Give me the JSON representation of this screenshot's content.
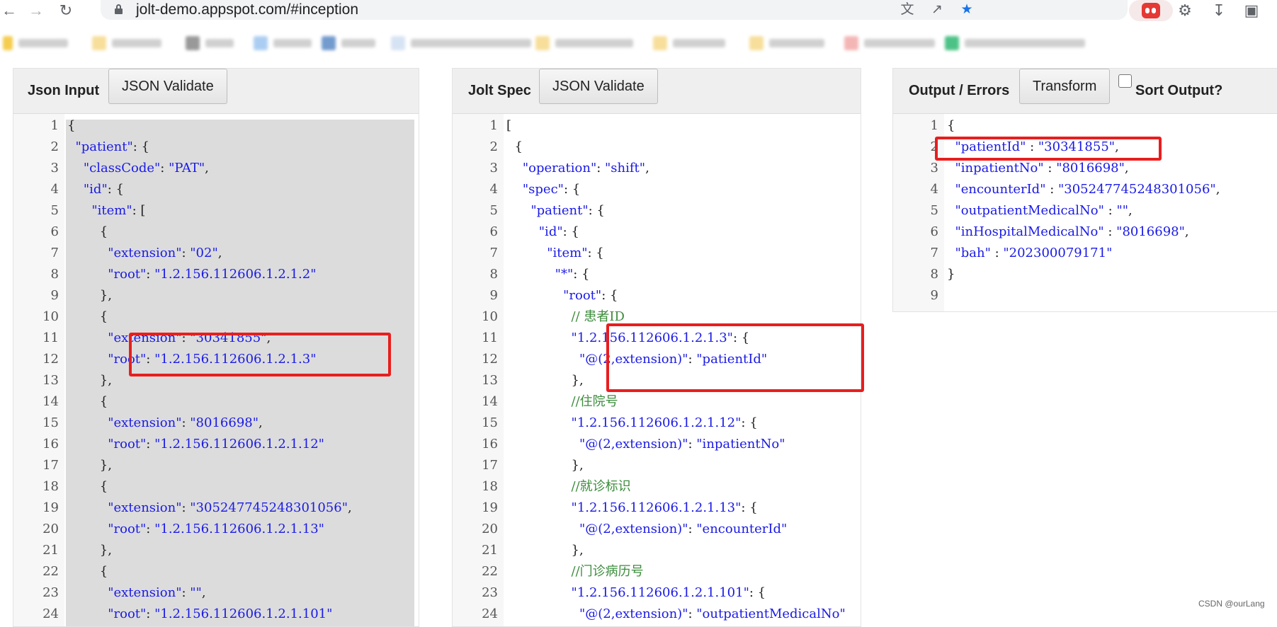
{
  "browser": {
    "url": "jolt-demo.appspot.com/#inception",
    "back_icon": "arrow-left-icon",
    "forward_icon": "arrow-right-icon",
    "reload_icon": "reload-icon",
    "bookmarks_blurred": true
  },
  "panels": {
    "input": {
      "title": "Json Input",
      "button": "JSON Validate",
      "lines": [
        "{",
        "  \"patient\": {",
        "    \"classCode\": \"PAT\",",
        "    \"id\": {",
        "      \"item\": [",
        "        {",
        "          \"extension\": \"02\",",
        "          \"root\": \"1.2.156.112606.1.2.1.2\"",
        "        },",
        "        {",
        "          \"extension\": \"30341855\",",
        "          \"root\": \"1.2.156.112606.1.2.1.3\"",
        "        },",
        "        {",
        "          \"extension\": \"8016698\",",
        "          \"root\": \"1.2.156.112606.1.2.1.12\"",
        "        },",
        "        {",
        "          \"extension\": \"305247745248301056\",",
        "          \"root\": \"1.2.156.112606.1.2.1.13\"",
        "        },",
        "        {",
        "          \"extension\": \"\",",
        "          \"root\": \"1.2.156.112606.1.2.1.101\""
      ],
      "line_numbers": [
        "1",
        "2",
        "3",
        "4",
        "5",
        "6",
        "7",
        "8",
        "9",
        "10",
        "11",
        "12",
        "13",
        "14",
        "15",
        "16",
        "17",
        "18",
        "19",
        "20",
        "21",
        "22",
        "23",
        "24"
      ]
    },
    "spec": {
      "title": "Jolt Spec",
      "button": "JSON Validate",
      "lines": [
        "[",
        "  {",
        "    \"operation\": \"shift\",",
        "    \"spec\": {",
        "      \"patient\": {",
        "        \"id\": {",
        "          \"item\": {",
        "            \"*\": {",
        "              \"root\": {",
        "                // 患者ID",
        "                \"1.2.156.112606.1.2.1.3\": {",
        "                  \"@(2,extension)\": \"patientId\"",
        "                },",
        "                //住院号",
        "                \"1.2.156.112606.1.2.1.12\": {",
        "                  \"@(2,extension)\": \"inpatientNo\"",
        "                },",
        "                //就诊标识",
        "                \"1.2.156.112606.1.2.1.13\": {",
        "                  \"@(2,extension)\": \"encounterId\"",
        "                },",
        "                //门诊病历号",
        "                \"1.2.156.112606.1.2.1.101\": {",
        "                  \"@(2,extension)\": \"outpatientMedicalNo\""
      ],
      "line_numbers": [
        "1",
        "2",
        "3",
        "4",
        "5",
        "6",
        "7",
        "8",
        "9",
        "10",
        "11",
        "12",
        "13",
        "14",
        "15",
        "16",
        "17",
        "18",
        "19",
        "20",
        "21",
        "22",
        "23",
        "24"
      ]
    },
    "output": {
      "title": "Output / Errors",
      "button": "Transform",
      "sort_label": "Sort Output?",
      "sort_checked": false,
      "lines": [
        "{",
        "  \"patientId\" : \"30341855\",",
        "  \"inpatientNo\" : \"8016698\",",
        "  \"encounterId\" : \"305247745248301056\",",
        "  \"outpatientMedicalNo\" : \"\",",
        "  \"inHospitalMedicalNo\" : \"8016698\",",
        "  \"bah\" : \"202300079171\"",
        "}",
        ""
      ],
      "line_numbers": [
        "1",
        "2",
        "3",
        "4",
        "5",
        "6",
        "7",
        "8",
        "9"
      ]
    }
  },
  "colors": {
    "highlight_box": "#e81e1e",
    "string": "#1a1ae6",
    "comment": "#3c8c3c"
  },
  "watermark": "CSDN @ourLang"
}
